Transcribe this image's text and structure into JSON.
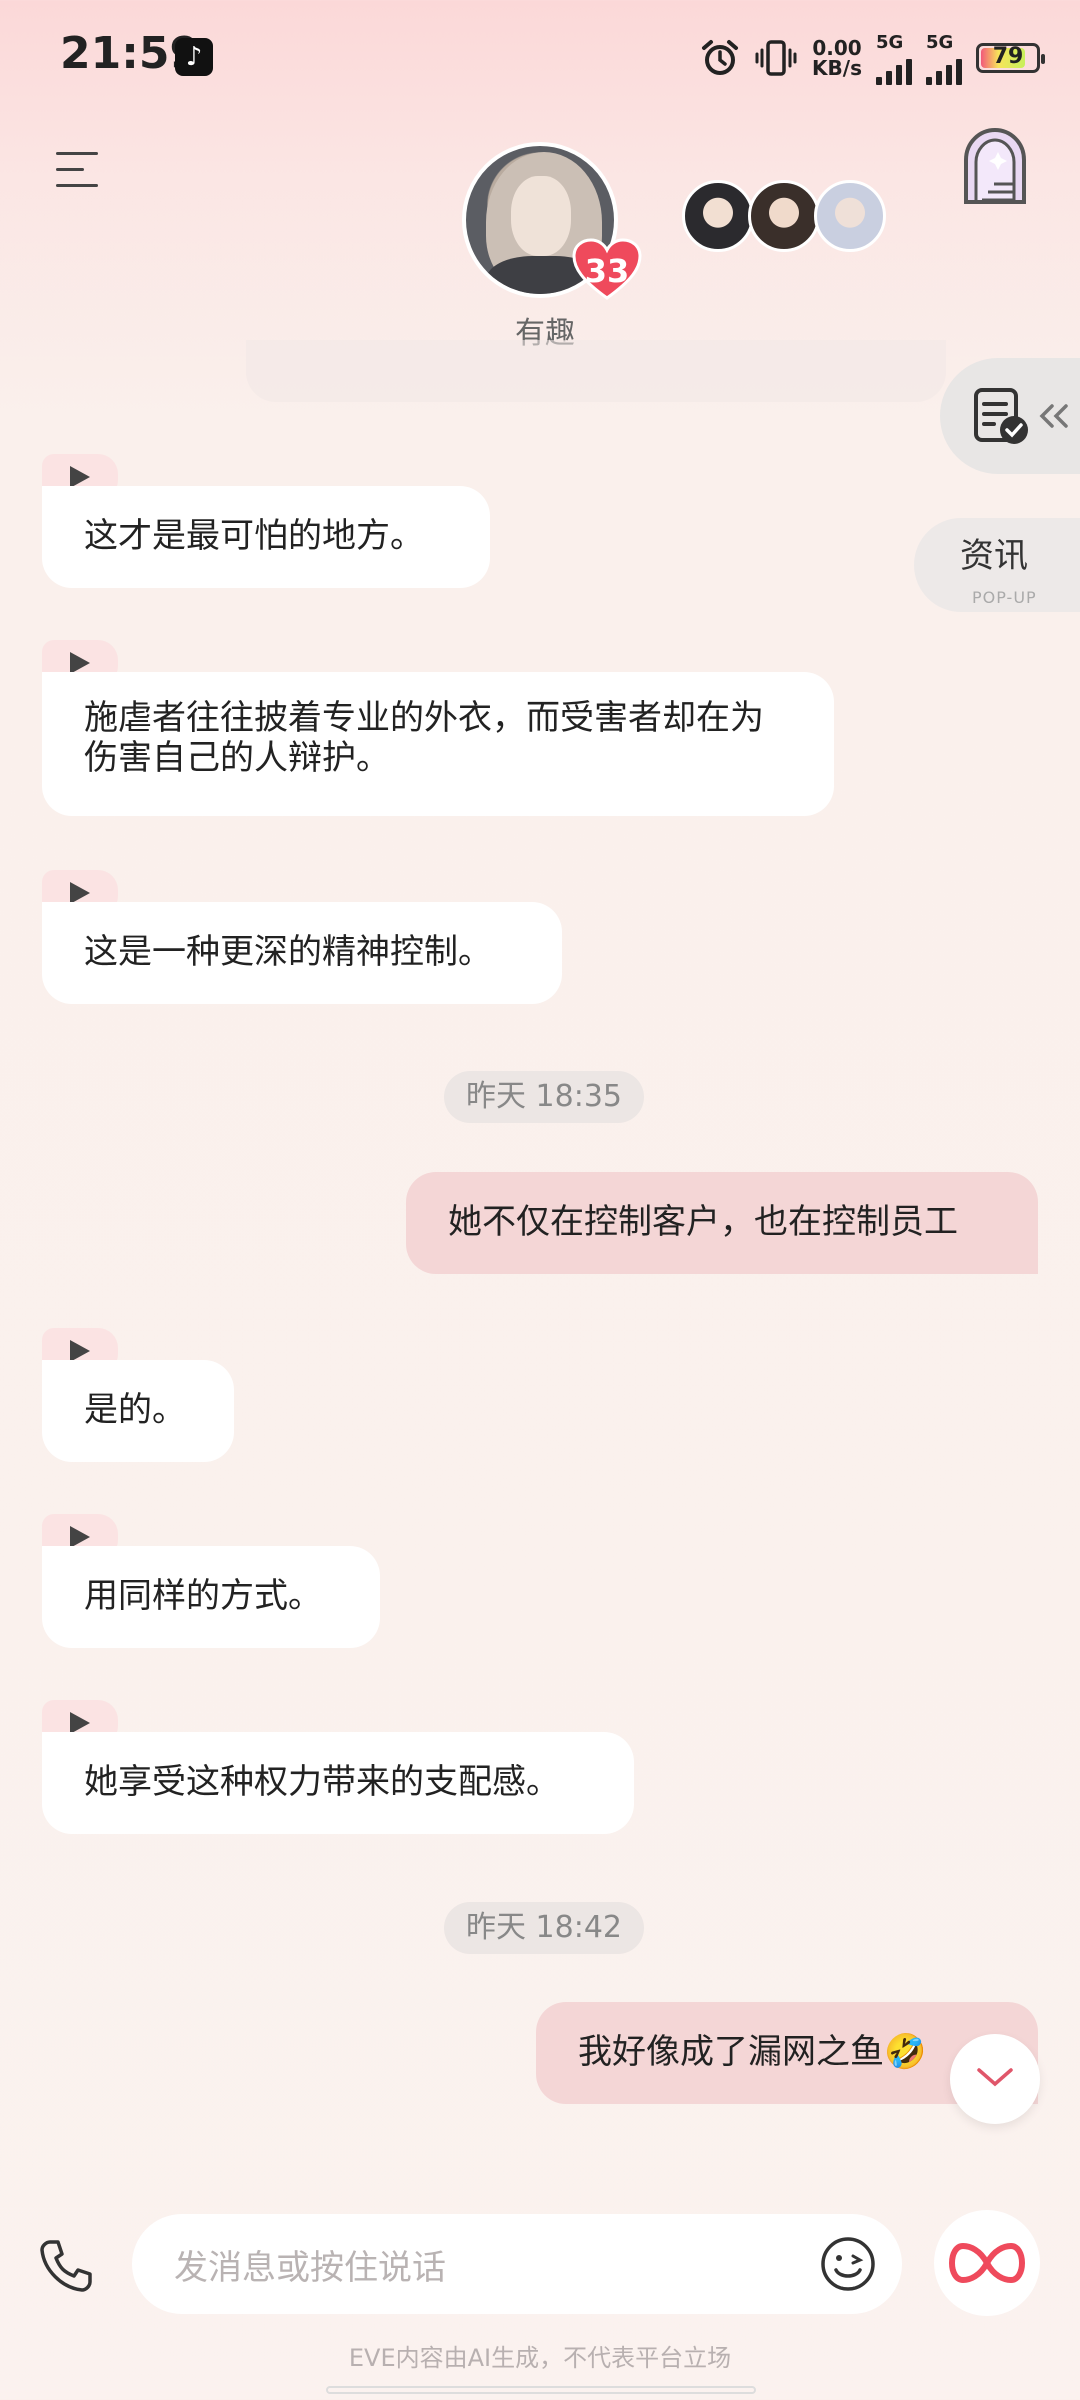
{
  "status_bar": {
    "time": "21:59",
    "net_speed_value": "0.00",
    "net_speed_unit": "KB/s",
    "sig1_label": "5G",
    "sig2_label": "5G",
    "battery_level": "79",
    "icons": [
      "tiktok-icon",
      "alarm-icon",
      "vibrate-icon"
    ]
  },
  "header": {
    "character_name": "有趣",
    "heart_count": "33"
  },
  "side": {
    "news_label": "资讯",
    "news_sub": "POP-UP"
  },
  "messages": [
    {
      "side": "left",
      "text": "这才是最可怕的地方。"
    },
    {
      "side": "left",
      "text": "施虐者往往披着专业的外衣，而受害者却在为伤害自己的人辩护。"
    },
    {
      "side": "left",
      "text": "这是一种更深的精神控制。"
    },
    {
      "side": "time",
      "text": "昨天 18:35"
    },
    {
      "side": "right",
      "text": "她不仅在控制客户，也在控制员工"
    },
    {
      "side": "left",
      "text": "是的。"
    },
    {
      "side": "left",
      "text": "用同样的方式。"
    },
    {
      "side": "left",
      "text": "她享受这种权力带来的支配感。"
    },
    {
      "side": "time",
      "text": "昨天 18:42"
    },
    {
      "side": "right",
      "text": "我好像成了漏网之鱼🤣"
    }
  ],
  "input": {
    "placeholder": "发消息或按住说话"
  },
  "footer": {
    "note": "EVE内容由AI生成，不代表平台立场"
  },
  "colors": {
    "accent": "#f0566a",
    "user_bubble": "#f4d6d6",
    "bot_bubble": "#ffffff"
  }
}
